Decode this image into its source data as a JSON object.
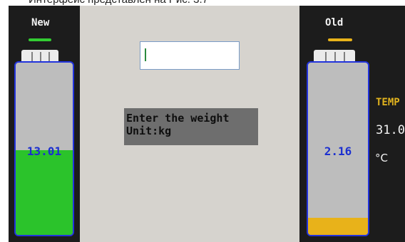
{
  "caption": {
    "text": "Интерфейс представлен на Рис. 3.7"
  },
  "input": {
    "value": ""
  },
  "prompt": {
    "line1": "Enter the weight",
    "line2": "Unit:kg"
  },
  "tank_new": {
    "title": "New",
    "value": "13.01",
    "fill_fraction": 0.49,
    "fill_color": "#2bc32b",
    "indicator_color": "#33cc33"
  },
  "tank_old": {
    "title": "Old",
    "value": "2.16",
    "fill_fraction": 0.1,
    "fill_color": "#e8b21a",
    "indicator_color": "#e8b21a"
  },
  "temperature": {
    "label": "TEMP",
    "value": "31.0",
    "unit": "°C"
  },
  "colors": {
    "background": "#1c1c1c",
    "panel": "#d6d3ce",
    "tank_border": "#2233dd",
    "value_text": "#1b2fd0"
  }
}
